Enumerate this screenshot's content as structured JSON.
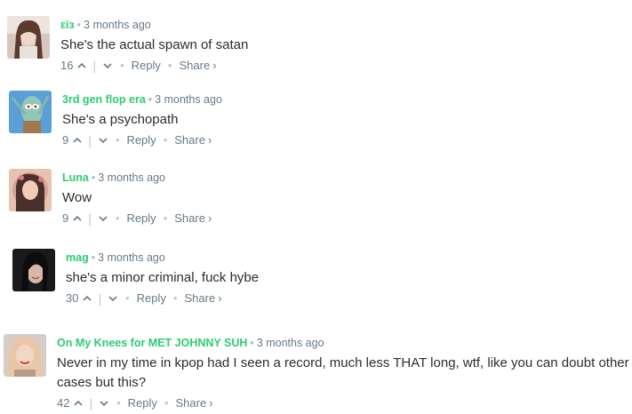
{
  "comments": [
    {
      "author": "εïз",
      "time": "3 months ago",
      "text": "She's the actual spawn of satan",
      "votes": "16",
      "reply": "Reply",
      "share": "Share",
      "share_arrow": "›"
    },
    {
      "author": "3rd gen flop era",
      "time": "3 months ago",
      "text": "She's a psychopath",
      "votes": "9",
      "reply": "Reply",
      "share": "Share",
      "share_arrow": "›"
    },
    {
      "author": "Luna",
      "time": "3 months ago",
      "text": "Wow",
      "votes": "9",
      "reply": "Reply",
      "share": "Share",
      "share_arrow": "›"
    },
    {
      "author": "mag",
      "time": "3 months ago",
      "text": "she's a minor criminal, fuck hybe",
      "votes": "30",
      "reply": "Reply",
      "share": "Share",
      "share_arrow": "›"
    },
    {
      "author": "On My Knees for MET JOHNNY SUH",
      "time": "3 months ago",
      "text": "Never in my time in kpop had I seen a record, much less THAT long, wtf, like you can doubt other cases but this?",
      "votes": "42",
      "reply": "Reply",
      "share": "Share",
      "share_arrow": "›"
    }
  ],
  "colors": {
    "author": "#2ecc71",
    "meta": "#687a86",
    "text": "#2a2e2e"
  }
}
